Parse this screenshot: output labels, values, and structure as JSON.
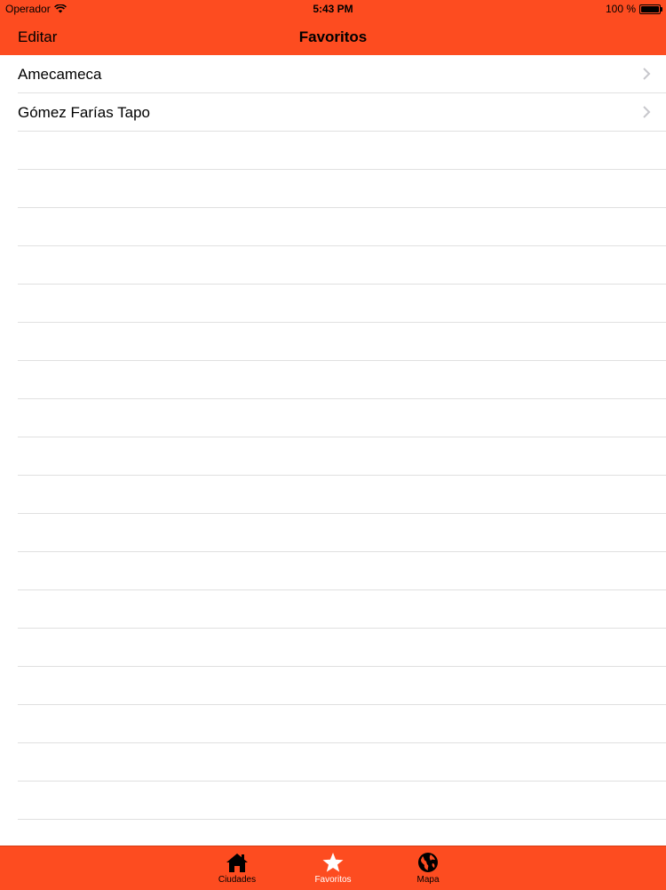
{
  "status_bar": {
    "carrier": "Operador",
    "time": "5:43 PM",
    "battery": "100 %"
  },
  "nav_bar": {
    "edit_label": "Editar",
    "title": "Favoritos"
  },
  "favorites": [
    {
      "label": "Amecameca",
      "icon": "chevron-right-icon"
    },
    {
      "label": "Gómez Farías Tapo",
      "icon": "chevron-right-icon"
    }
  ],
  "tab_bar": {
    "items": [
      {
        "label": "Ciudades",
        "icon": "home-icon",
        "active": false
      },
      {
        "label": "Favoritos",
        "icon": "star-icon",
        "active": true
      },
      {
        "label": "Mapa",
        "icon": "globe-icon",
        "active": false
      }
    ]
  },
  "colors": {
    "accent": "#fd4c20",
    "active_tab": "#ffffff",
    "separator": "#e0e0e0"
  }
}
